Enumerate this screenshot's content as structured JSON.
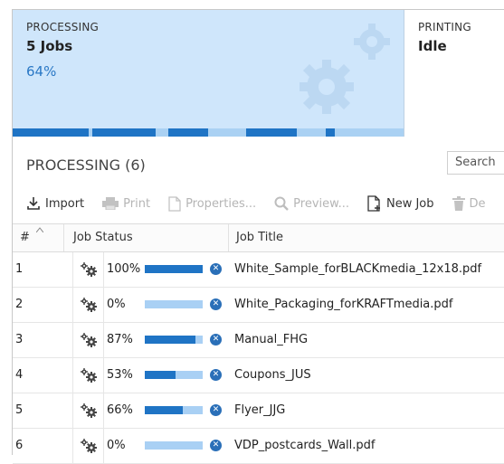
{
  "status": {
    "processing": {
      "label": "PROCESSING",
      "value": "5 Jobs",
      "percent": "64%",
      "progress": 0.64
    },
    "printing": {
      "label": "PRINTING",
      "value": "Idle"
    }
  },
  "section": {
    "title": "PROCESSING (6)"
  },
  "search": {
    "placeholder": "Search"
  },
  "toolbar": {
    "import_label": "Import",
    "print_label": "Print",
    "properties_label": "Properties...",
    "preview_label": "Preview...",
    "newjob_label": "New Job",
    "delete_label": "De"
  },
  "table": {
    "columns": {
      "num": "#",
      "status": "Job Status",
      "title": "Job Title"
    },
    "rows": [
      {
        "num": "1",
        "percent": "100%",
        "progress": 1.0,
        "title": "White_Sample_forBLACKmedia_12x18.pdf"
      },
      {
        "num": "2",
        "percent": "0%",
        "progress": 0.0,
        "title": "White_Packaging_forKRAFTmedia.pdf"
      },
      {
        "num": "3",
        "percent": "87%",
        "progress": 0.87,
        "title": "Manual_FHG"
      },
      {
        "num": "4",
        "percent": "53%",
        "progress": 0.53,
        "title": "Coupons_JUS"
      },
      {
        "num": "5",
        "percent": "66%",
        "progress": 0.66,
        "title": "Flyer_JJG"
      },
      {
        "num": "6",
        "percent": "0%",
        "progress": 0.0,
        "title": "VDP_postcards_Wall.pdf"
      }
    ]
  },
  "colors": {
    "accent": "#1f74c5",
    "panel": "#cfe6fb",
    "track": "#a9d0f4"
  },
  "icons": [
    "gears-icon",
    "import-icon",
    "print-icon",
    "properties-icon",
    "preview-icon",
    "new-job-icon",
    "delete-icon",
    "cancel-icon",
    "sort-icon"
  ]
}
